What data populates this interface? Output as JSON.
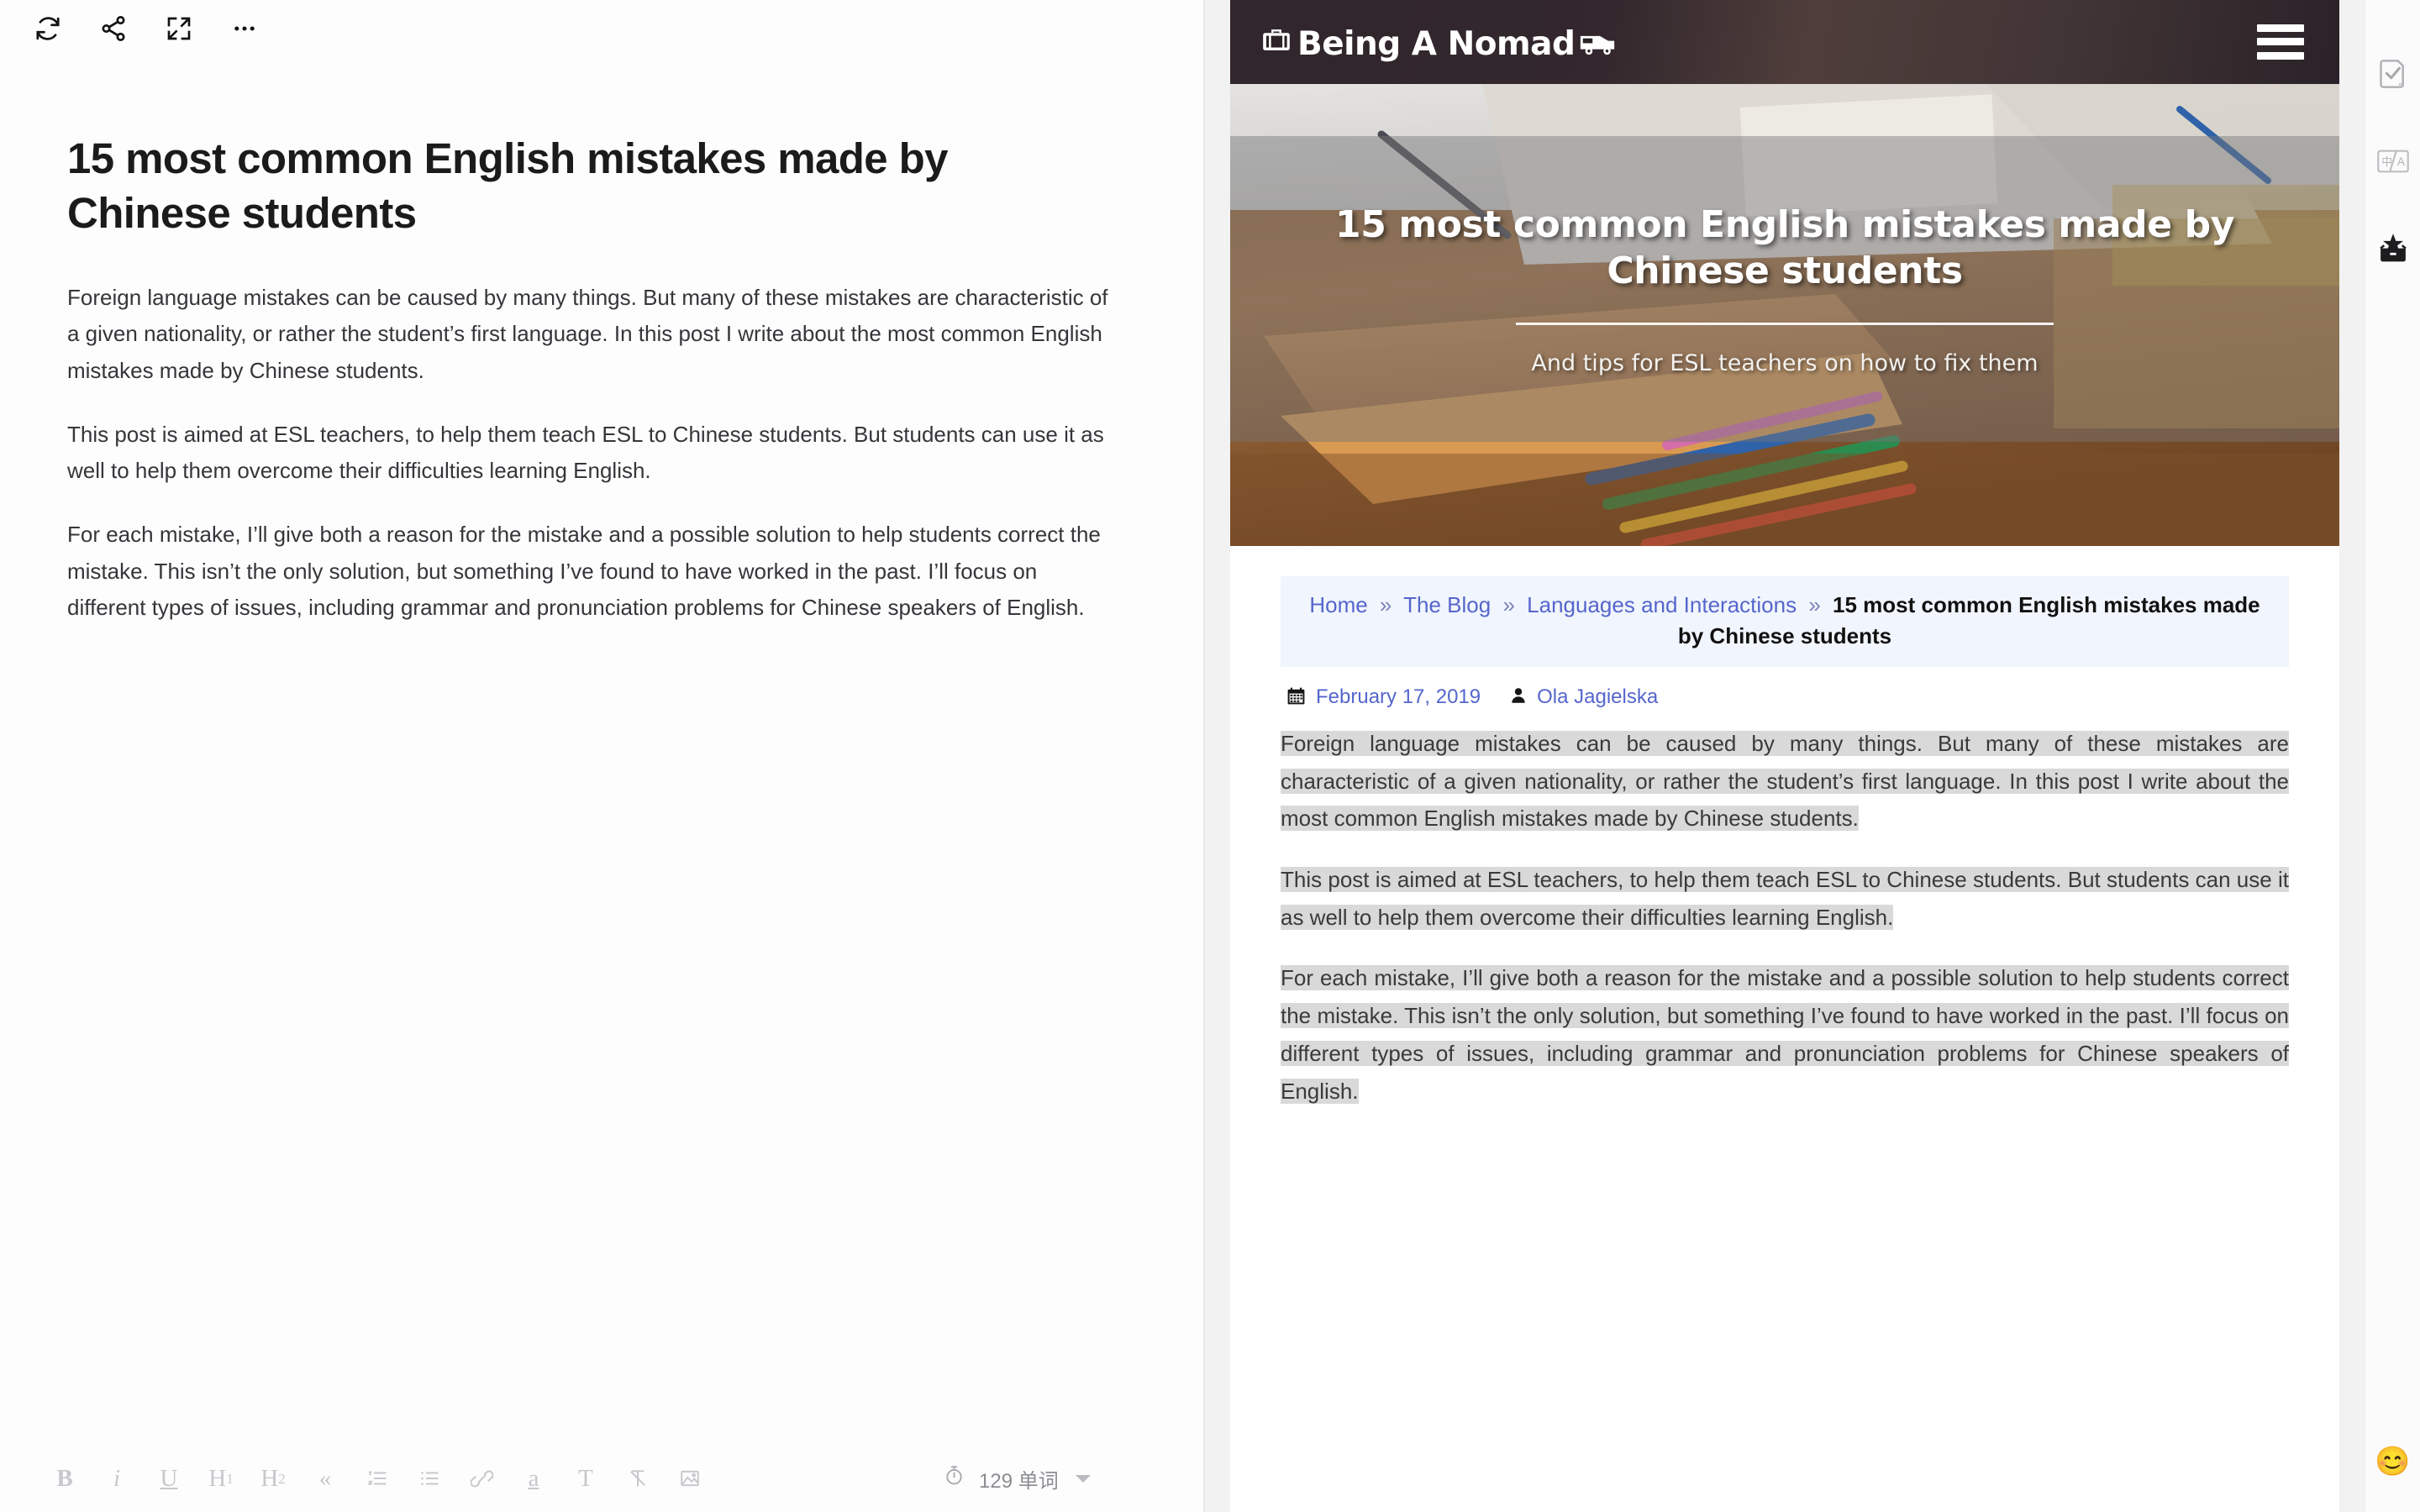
{
  "editor": {
    "toolbar_top": [
      {
        "name": "refresh-icon",
        "label": "Refresh"
      },
      {
        "name": "share-icon",
        "label": "Share"
      },
      {
        "name": "fullscreen-icon",
        "label": "Fullscreen"
      },
      {
        "name": "more-options-icon",
        "label": "More"
      }
    ],
    "title": "15 most common English mistakes made by Chinese students",
    "paragraphs": [
      "Foreign language mistakes can be caused by many things. But many of these mistakes are characteristic of a given nationality, or rather the student’s first language. In this post I write about the most common English mistakes made by Chinese students.",
      "This post is aimed at ESL teachers, to help them teach ESL to Chinese students. But students can use it as well to help them overcome their difficulties learning English.",
      "For each mistake, I’ll give both a reason for the mistake and a possible solution to help students correct the mistake. This isn’t the only solution, but something I’ve found to have worked in the past. I’ll focus on different types of issues, including grammar and pronunciation problems for Chinese speakers of English."
    ],
    "format_buttons": [
      {
        "name": "bold-button",
        "label": "B"
      },
      {
        "name": "italic-button",
        "label": "i"
      },
      {
        "name": "underline-button",
        "label": "U"
      },
      {
        "name": "heading-1-button",
        "label": "H",
        "sub": "1"
      },
      {
        "name": "heading-2-button",
        "label": "H",
        "sub": "2"
      },
      {
        "name": "blockquote-button",
        "label": "«"
      },
      {
        "name": "ordered-list-button",
        "label": ""
      },
      {
        "name": "bullet-list-button",
        "label": ""
      },
      {
        "name": "link-button",
        "label": ""
      },
      {
        "name": "highlight-button",
        "label": "a"
      },
      {
        "name": "text-style-button",
        "label": "T"
      },
      {
        "name": "clear-format-button",
        "label": ""
      },
      {
        "name": "insert-image-button",
        "label": ""
      }
    ],
    "word_count": "129 单词"
  },
  "preview": {
    "site_name": "Being A Nomad",
    "hero": {
      "title": "15 most common English mistakes made by Chinese students",
      "subtitle": "And tips for ESL teachers on how to fix them"
    },
    "breadcrumb": {
      "items": [
        {
          "label": "Home",
          "current": false
        },
        {
          "label": "The Blog",
          "current": false
        },
        {
          "label": "Languages and Interactions",
          "current": false
        }
      ],
      "separator": "»",
      "current": "15 most common English mistakes made by Chinese students"
    },
    "meta": {
      "date": "February 17, 2019",
      "author": "Ola Jagielska"
    },
    "paragraphs": [
      "Foreign language mistakes can be caused by many things. But many of these mistakes are characteristic of a given nationality, or rather the student’s first language. In this post I write about the most common English mistakes made by Chinese students.",
      "This post is aimed at ESL teachers, to help them teach ESL to Chinese students. But students can use it as well to help them overcome their difficulties learning English.",
      "For each mistake, I’ll give both a reason for the mistake and a possible solution to help students correct the mistake. This isn’t the only solution, but something I’ve found to have worked in the past. I’ll focus on different types of issues, including grammar and pronunciation problems for Chinese speakers of English."
    ]
  },
  "rail": {
    "items": [
      {
        "name": "document-check-icon",
        "label": "Proofread"
      },
      {
        "name": "translate-icon",
        "label": "Translate"
      },
      {
        "name": "toolbox-icon",
        "label": "Tools"
      }
    ],
    "emoji": "😊"
  },
  "colors": {
    "accent_link": "#5566cc",
    "header_bg": "#2b2227",
    "highlight": "#d9d9d9",
    "breadcrumb_bg": "#f1f5fd"
  }
}
